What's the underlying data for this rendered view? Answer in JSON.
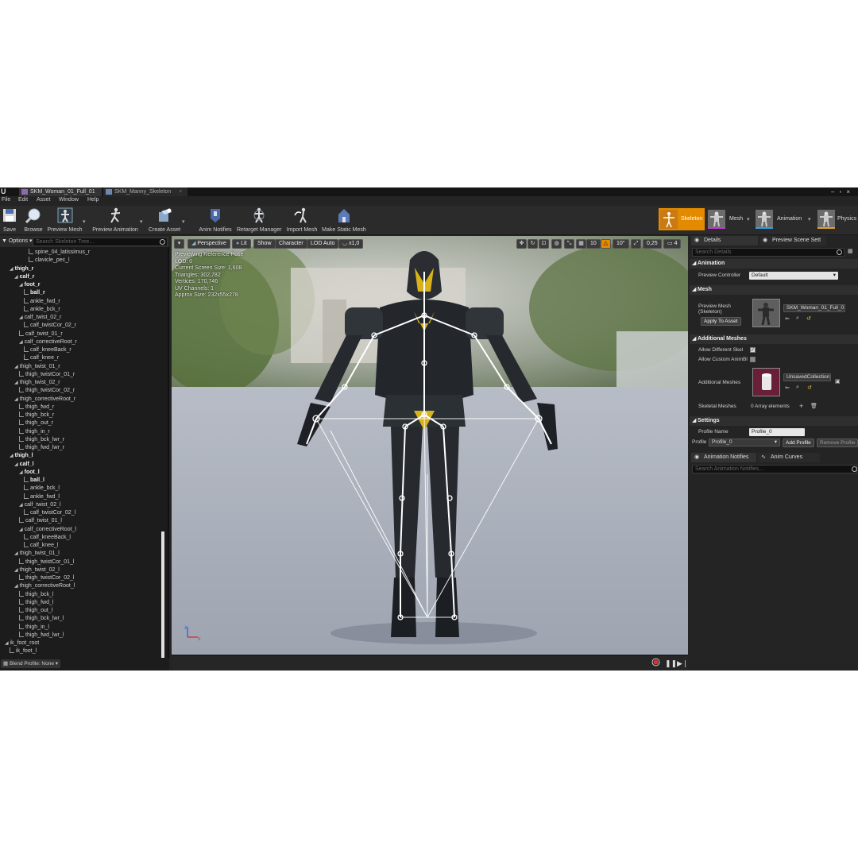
{
  "tabs": [
    {
      "label": "SKM_Woman_01_Full_01"
    },
    {
      "label": "SKM_Manny_Skeleton"
    }
  ],
  "menu": [
    "File",
    "Edit",
    "Asset",
    "Window",
    "Help"
  ],
  "toolbar": {
    "save": "Save",
    "browse": "Browse",
    "preview_mesh": "Preview Mesh",
    "preview_animation": "Preview Animation",
    "create_asset": "Create Asset",
    "anim_notifies": "Anim Notifies",
    "retarget_manager": "Retarget Manager",
    "import_mesh": "Import Mesh",
    "make_static_mesh": "Make Static Mesh"
  },
  "modes": {
    "skeleton": "Skeleton",
    "mesh": "Mesh",
    "animation": "Animation",
    "physics": "Physics"
  },
  "skeleton_tree": {
    "options_label": "Options",
    "search_placeholder": "Search Skeleton Tree...",
    "rows": [
      {
        "label": "spine_04_latissimus_r",
        "depth": 5,
        "bold": false,
        "expander": false
      },
      {
        "label": "clavicle_pec_l",
        "depth": 5,
        "bold": false,
        "expander": false
      },
      {
        "label": "thigh_r",
        "depth": 1,
        "bold": true,
        "expander": true
      },
      {
        "label": "calf_r",
        "depth": 2,
        "bold": true,
        "expander": true
      },
      {
        "label": "foot_r",
        "depth": 3,
        "bold": true,
        "expander": true
      },
      {
        "label": "ball_r",
        "depth": 4,
        "bold": true,
        "expander": false
      },
      {
        "label": "ankle_fwd_r",
        "depth": 4,
        "bold": false,
        "expander": false
      },
      {
        "label": "ankle_bck_r",
        "depth": 4,
        "bold": false,
        "expander": false
      },
      {
        "label": "calf_twist_02_r",
        "depth": 3,
        "bold": false,
        "expander": true
      },
      {
        "label": "calf_twistCor_02_r",
        "depth": 4,
        "bold": false,
        "expander": false
      },
      {
        "label": "calf_twist_01_r",
        "depth": 3,
        "bold": false,
        "expander": false
      },
      {
        "label": "calf_correctiveRoot_r",
        "depth": 3,
        "bold": false,
        "expander": true
      },
      {
        "label": "calf_kneeBack_r",
        "depth": 4,
        "bold": false,
        "expander": false
      },
      {
        "label": "calf_knee_r",
        "depth": 4,
        "bold": false,
        "expander": false
      },
      {
        "label": "thigh_twist_01_r",
        "depth": 2,
        "bold": false,
        "expander": true
      },
      {
        "label": "thigh_twistCor_01_r",
        "depth": 3,
        "bold": false,
        "expander": false
      },
      {
        "label": "thigh_twist_02_r",
        "depth": 2,
        "bold": false,
        "expander": true
      },
      {
        "label": "thigh_twistCor_02_r",
        "depth": 3,
        "bold": false,
        "expander": false
      },
      {
        "label": "thigh_correctiveRoot_r",
        "depth": 2,
        "bold": false,
        "expander": true
      },
      {
        "label": "thigh_fwd_r",
        "depth": 3,
        "bold": false,
        "expander": false
      },
      {
        "label": "thigh_bck_r",
        "depth": 3,
        "bold": false,
        "expander": false
      },
      {
        "label": "thigh_out_r",
        "depth": 3,
        "bold": false,
        "expander": false
      },
      {
        "label": "thigh_in_r",
        "depth": 3,
        "bold": false,
        "expander": false
      },
      {
        "label": "thigh_bck_lwr_r",
        "depth": 3,
        "bold": false,
        "expander": false
      },
      {
        "label": "thigh_fwd_lwr_r",
        "depth": 3,
        "bold": false,
        "expander": false
      },
      {
        "label": "thigh_l",
        "depth": 1,
        "bold": true,
        "expander": true
      },
      {
        "label": "calf_l",
        "depth": 2,
        "bold": true,
        "expander": true
      },
      {
        "label": "foot_l",
        "depth": 3,
        "bold": true,
        "expander": true
      },
      {
        "label": "ball_l",
        "depth": 4,
        "bold": true,
        "expander": false
      },
      {
        "label": "ankle_bck_l",
        "depth": 4,
        "bold": false,
        "expander": false
      },
      {
        "label": "ankle_fwd_l",
        "depth": 4,
        "bold": false,
        "expander": false
      },
      {
        "label": "calf_twist_02_l",
        "depth": 3,
        "bold": false,
        "expander": true
      },
      {
        "label": "calf_twistCor_02_l",
        "depth": 4,
        "bold": false,
        "expander": false
      },
      {
        "label": "calf_twist_01_l",
        "depth": 3,
        "bold": false,
        "expander": false
      },
      {
        "label": "calf_correctiveRoot_l",
        "depth": 3,
        "bold": false,
        "expander": true
      },
      {
        "label": "calf_kneeBack_l",
        "depth": 4,
        "bold": false,
        "expander": false
      },
      {
        "label": "calf_knee_l",
        "depth": 4,
        "bold": false,
        "expander": false
      },
      {
        "label": "thigh_twist_01_l",
        "depth": 2,
        "bold": false,
        "expander": true
      },
      {
        "label": "thigh_twistCor_01_l",
        "depth": 3,
        "bold": false,
        "expander": false
      },
      {
        "label": "thigh_twist_02_l",
        "depth": 2,
        "bold": false,
        "expander": true
      },
      {
        "label": "thigh_twistCor_02_l",
        "depth": 3,
        "bold": false,
        "expander": false
      },
      {
        "label": "thigh_correctiveRoot_l",
        "depth": 2,
        "bold": false,
        "expander": true
      },
      {
        "label": "thigh_bck_l",
        "depth": 3,
        "bold": false,
        "expander": false
      },
      {
        "label": "thigh_fwd_l",
        "depth": 3,
        "bold": false,
        "expander": false
      },
      {
        "label": "thigh_out_l",
        "depth": 3,
        "bold": false,
        "expander": false
      },
      {
        "label": "thigh_bck_lwr_l",
        "depth": 3,
        "bold": false,
        "expander": false
      },
      {
        "label": "thigh_in_l",
        "depth": 3,
        "bold": false,
        "expander": false
      },
      {
        "label": "thigh_fwd_lwr_l",
        "depth": 3,
        "bold": false,
        "expander": false
      },
      {
        "label": "ik_foot_root",
        "depth": 0,
        "bold": false,
        "expander": true
      },
      {
        "label": "ik_foot_l",
        "depth": 1,
        "bold": false,
        "expander": false
      }
    ],
    "blend_profile": "Blend Profile: None"
  },
  "viewport": {
    "perspective": "Perspective",
    "lit": "Lit",
    "show": "Show",
    "character": "Character",
    "lod": "LOD Auto",
    "speed": "x1,0",
    "grid_snap": "10",
    "rot_snap": "10°",
    "scale_snap": "0,25",
    "cam_speed": "4",
    "stats": [
      "Previewing Reference Pose",
      "LOD: 0",
      "Current Screen Size: 1,608",
      "Triangles: 302,782",
      "Vertices: 170,746",
      "UV Channels: 1",
      "Approx Size: 232x55x278"
    ]
  },
  "details": {
    "tab_details": "Details",
    "tab_preview": "Preview Scene Sett",
    "search_placeholder": "Search Details",
    "animation_section": "Animation",
    "preview_controller_label": "Preview Controller",
    "preview_controller_value": "Default",
    "mesh_section": "Mesh",
    "preview_mesh_label": "Preview Mesh (Skeleton)",
    "preview_mesh_value": "SKM_Woman_01_Full_0",
    "apply_to_asset": "Apply To Asset",
    "additional_meshes_section": "Additional Meshes",
    "allow_different_skel": "Allow Different Skel",
    "allow_custom_anim": "Allow Custom AnimBl",
    "additional_meshes_label": "Additional Meshes",
    "additional_meshes_value": "UnsavedCollection",
    "skeletal_meshes_label": "Skeletal Meshes",
    "skeletal_meshes_value": "0 Array elements",
    "settings_section": "Settings",
    "profile_name_label": "Profile Name",
    "profile_name_value": "Profile_0",
    "profile_label": "Profile",
    "profile_value": "Profile_0",
    "add_profile": "Add Profile",
    "remove_profile": "Remove Profile"
  },
  "notifies": {
    "tab_anim_notifies": "Animation Notifies",
    "tab_anim_curves": "Anim Curves",
    "search_placeholder": "Search Animation Notifies..."
  },
  "colors": {
    "accent_orange": "#e48a00",
    "panel_bg": "#242424",
    "tree_bg": "#1c1c1c"
  }
}
